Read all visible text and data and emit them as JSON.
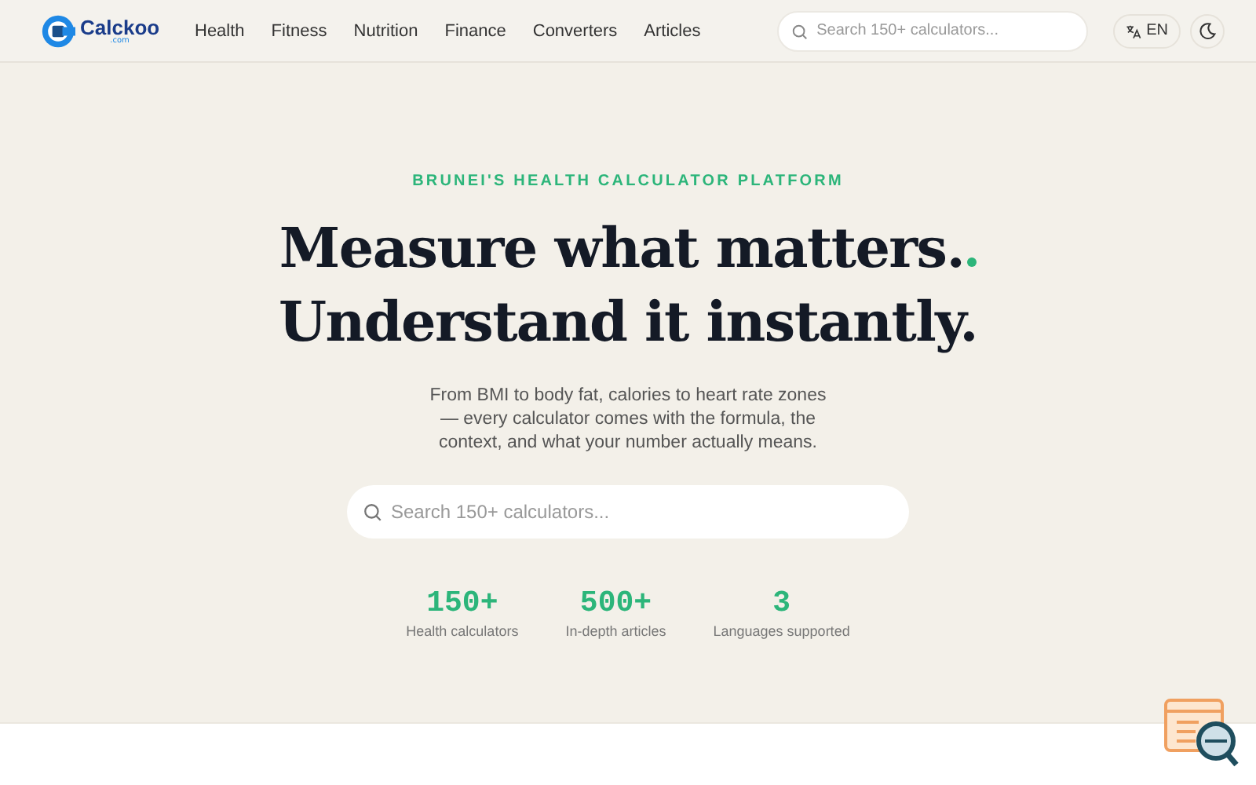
{
  "header": {
    "brand": "Calckoo",
    "brand_suffix": ".com",
    "nav": [
      "Health",
      "Fitness",
      "Nutrition",
      "Finance",
      "Converters",
      "Articles"
    ],
    "search": {
      "placeholder": "Search 150+ calculators..."
    },
    "language": "EN"
  },
  "hero": {
    "eyebrow": "BRUNEI'S HEALTH CALCULATOR PLATFORM",
    "headline": [
      "Measure what matters.",
      "Understand it instantly."
    ],
    "accent_dot": true,
    "intro": "From BMI to body fat, calories to heart rate zones — every calculator comes with the formula, the context, and what your number actually means.",
    "search": {
      "placeholder": "Search 150+ calculators..."
    },
    "stats": [
      {
        "value": "150+",
        "label": "Health calculators"
      },
      {
        "value": "500+",
        "label": "In-depth articles"
      },
      {
        "value": "3",
        "label": "Languages supported"
      }
    ]
  }
}
